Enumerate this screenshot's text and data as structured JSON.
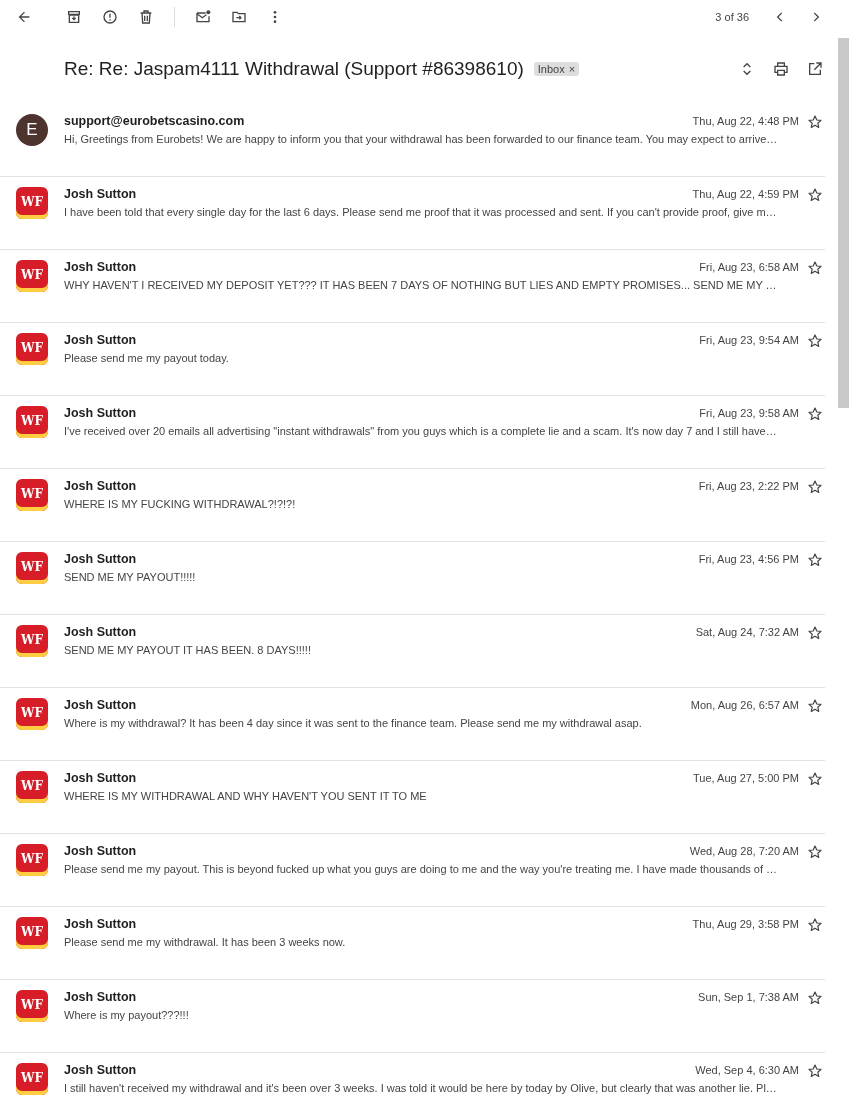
{
  "toolbar": {
    "counter": "3 of 36"
  },
  "subject": {
    "title": "Re: Re: Jaspam4111 Withdrawal (Support #86398610)",
    "label": "Inbox",
    "label_close": "×"
  },
  "messages": [
    {
      "sender": "support@eurobetscasino.com",
      "date": "Thu, Aug 22, 4:48 PM",
      "preview": "Hi, Greetings from Eurobets! We are happy to inform you that your withdrawal has been forwarded to our finance team. You may expect to arrive…",
      "avatar": {
        "kind": "letter",
        "text": "E"
      },
      "starred": false
    },
    {
      "sender": "Josh Sutton",
      "date": "Thu, Aug 22, 4:59 PM",
      "preview": "I have been told that every single day for the last 6 days. Please send me proof that it was processed and sent. If you can't provide proof, give m…",
      "avatar": {
        "kind": "logo",
        "text": "WF"
      },
      "starred": false
    },
    {
      "sender": "Josh Sutton",
      "date": "Fri, Aug 23, 6:58 AM",
      "preview": "WHY HAVEN'T I RECEIVED MY DEPOSIT YET??? IT HAS BEEN 7 DAYS OF NOTHING BUT LIES AND EMPTY PROMISES... SEND ME MY …",
      "avatar": {
        "kind": "logo",
        "text": "WF"
      },
      "starred": false
    },
    {
      "sender": "Josh Sutton",
      "date": "Fri, Aug 23, 9:54 AM",
      "preview": "Please send me my payout today.",
      "avatar": {
        "kind": "logo",
        "text": "WF"
      },
      "starred": false
    },
    {
      "sender": "Josh Sutton",
      "date": "Fri, Aug 23, 9:58 AM",
      "preview": "I've received over 20 emails all advertising \"instant withdrawals\" from you guys which is a complete lie and a scam. It's now day 7 and I still have…",
      "avatar": {
        "kind": "logo",
        "text": "WF"
      },
      "starred": false
    },
    {
      "sender": "Josh Sutton",
      "date": "Fri, Aug 23, 2:22 PM",
      "preview": "WHERE IS MY FUCKING WITHDRAWAL?!?!?!",
      "avatar": {
        "kind": "logo",
        "text": "WF"
      },
      "starred": false
    },
    {
      "sender": "Josh Sutton",
      "date": "Fri, Aug 23, 4:56 PM",
      "preview": "SEND ME MY PAYOUT!!!!!",
      "avatar": {
        "kind": "logo",
        "text": "WF"
      },
      "starred": false
    },
    {
      "sender": "Josh Sutton",
      "date": "Sat, Aug 24, 7:32 AM",
      "preview": "SEND ME MY PAYOUT IT HAS BEEN. 8 DAYS!!!!!",
      "avatar": {
        "kind": "logo",
        "text": "WF"
      },
      "starred": false
    },
    {
      "sender": "Josh Sutton",
      "date": "Mon, Aug 26, 6:57 AM",
      "preview": "Where is my withdrawal? It has been 4 day since it was sent to the finance team. Please send me my withdrawal asap.",
      "avatar": {
        "kind": "logo",
        "text": "WF"
      },
      "starred": false
    },
    {
      "sender": "Josh Sutton",
      "date": "Tue, Aug 27, 5:00 PM",
      "preview": "WHERE IS MY WITHDRAWAL AND WHY HAVEN'T YOU SENT IT TO ME",
      "avatar": {
        "kind": "logo",
        "text": "WF"
      },
      "starred": false
    },
    {
      "sender": "Josh Sutton",
      "date": "Wed, Aug 28, 7:20 AM",
      "preview": "Please send me my payout. This is beyond fucked up what you guys are doing to me and the way you're treating me. I have made thousands of …",
      "avatar": {
        "kind": "logo",
        "text": "WF"
      },
      "starred": false
    },
    {
      "sender": "Josh Sutton",
      "date": "Thu, Aug 29, 3:58 PM",
      "preview": "Please send me my withdrawal. It has been 3 weeks now.",
      "avatar": {
        "kind": "logo",
        "text": "WF"
      },
      "starred": false
    },
    {
      "sender": "Josh Sutton",
      "date": "Sun, Sep 1, 7:38 AM",
      "preview": "Where is my payout???!!!",
      "avatar": {
        "kind": "logo",
        "text": "WF"
      },
      "starred": false
    },
    {
      "sender": "Josh Sutton",
      "date": "Wed, Sep 4, 6:30 AM",
      "preview": "I still haven't received my withdrawal and it's been over 3 weeks. I was told it would be here by today by Olive, but clearly that was another lie. Pl…",
      "avatar": {
        "kind": "logo",
        "text": "WF"
      },
      "starred": false
    }
  ]
}
